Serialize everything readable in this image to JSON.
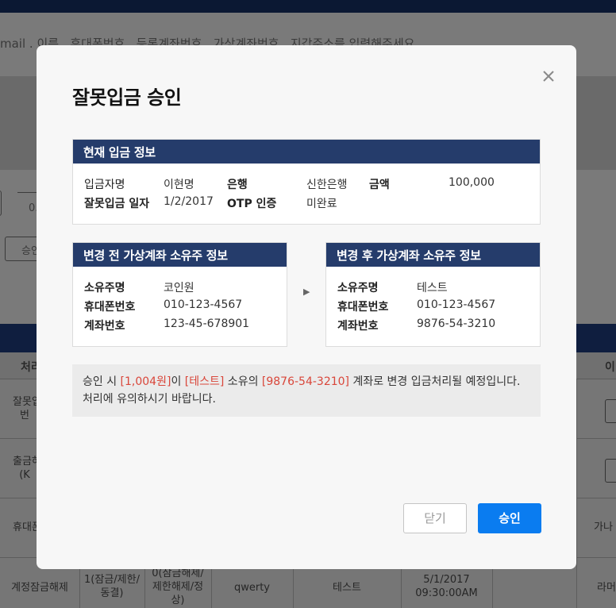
{
  "background": {
    "instruction_text": "mail . 이름 , 휴대폰번호 , 등록계좌번호 , 가상계좌번호 , 지갑주소를 입력해주세요",
    "input_value": "0.",
    "approve_button": "승인",
    "table_header_left": "처리",
    "table_header_right": "이",
    "rows": [
      {
        "cell1": "잘못입\n번",
        "right": ""
      },
      {
        "cell1": "출금허\n(K",
        "right": ""
      },
      {
        "cell1": "휴대폰",
        "right": "가나"
      },
      {
        "cell1": "계정잠금해제",
        "cell2": "1(잠금/제한/\n동결)",
        "cell3": "0(잠금해제/\n제한해제/정\n상)",
        "cell4": "qwerty",
        "cell5": "테스트",
        "cell6": "5/1/2017\n09:30:00AM",
        "right": "라머"
      }
    ]
  },
  "modal": {
    "title": "잘못입금 승인",
    "current_info": {
      "header": "현재 입금 정보",
      "depositor_label": "입금자명",
      "depositor_value": "이현명",
      "bank_label": "은행",
      "bank_value": "신한은행",
      "amount_label": "금액",
      "amount_value": "100,000",
      "date_label": "잘못입금 일자",
      "date_value": "1/2/2017",
      "otp_label": "OTP 인증",
      "otp_value": "미완료"
    },
    "before_info": {
      "header": "변경 전 가상계좌 소유주 정보",
      "owner_label": "소유주명",
      "owner_value": "코인원",
      "phone_label": "휴대폰번호",
      "phone_value": "010-123-4567",
      "account_label": "계좌번호",
      "account_value": "123-45-678901"
    },
    "after_info": {
      "header": "변경 후 가상계좌 소유주 정보",
      "owner_label": "소유주명",
      "owner_value": "테스트",
      "phone_label": "휴대폰번호",
      "phone_value": "010-123-4567",
      "account_label": "계좌번호",
      "account_value": "9876-54-3210"
    },
    "notice": {
      "p1": "승인 시 ",
      "amount": "[1,004원]",
      "p2": "이 ",
      "owner": "[테스트]",
      "p3": " 소유의 ",
      "account": "[9876-54-3210]",
      "p4": " 계좌로 변경 입금처리될 예정입니다.",
      "line2": "처리에 유의하시기 바랍니다."
    },
    "buttons": {
      "close": "닫기",
      "approve": "승인"
    }
  },
  "colors": {
    "panel_header": "#253c6b",
    "primary_button": "#0a7cf0",
    "highlight": "#d9463a",
    "top_bar": "#0b1833"
  },
  "icons": {
    "close": "close-icon",
    "arrow": "arrow-right-icon"
  }
}
